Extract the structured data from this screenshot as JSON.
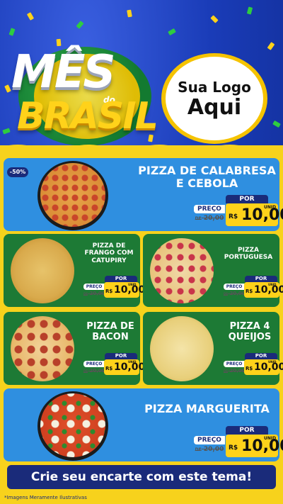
{
  "header": {
    "title_line1": "MÊS",
    "title_small": "do",
    "title_line2": "BRASIL",
    "logo_line1": "Sua Logo",
    "logo_line2": "Aqui"
  },
  "colors": {
    "blue_bg": "#1a3cb8",
    "yellow": "#f7d21c",
    "card_blue": "#2f8fe0",
    "card_green": "#1d7a35",
    "dark_blue": "#1a2b7a"
  },
  "price_common": {
    "por": "POR",
    "preco": "PREÇO",
    "old_prefix": "DE",
    "old_value": "20,00",
    "currency": "R$",
    "value": "10,00",
    "unit": "UNID"
  },
  "products": [
    {
      "name": "PIZZA DE CALABRESA E CEBOLA",
      "badge": "-50%"
    },
    {
      "name": "PIZZA DE FRANGO COM CATUPIRY"
    },
    {
      "name": "PIZZA PORTUGUESA"
    },
    {
      "name": "PIZZA DE BACON"
    },
    {
      "name": "PIZZA 4 QUEIJOS"
    },
    {
      "name": "PIZZA MARGUERITA"
    }
  ],
  "footer": {
    "cta": "Crie seu encarte com este tema!",
    "disclaimer": "*Imagens Meramente Ilustrativas"
  }
}
